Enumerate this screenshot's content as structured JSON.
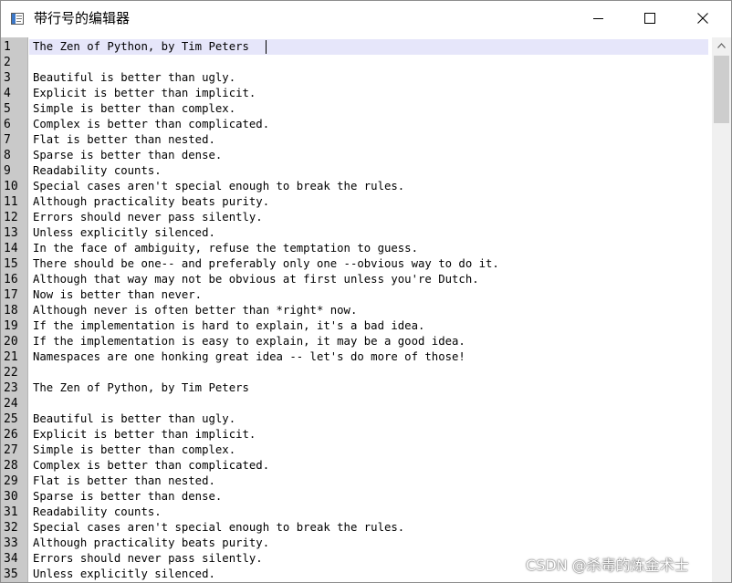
{
  "window": {
    "title": "带行号的编辑器",
    "controls": {
      "minimize": "minimize-icon",
      "maximize": "maximize-icon",
      "close": "close-icon"
    }
  },
  "editor": {
    "current_line": 1,
    "line_numbers": [
      "1",
      "2",
      "3",
      "4",
      "5",
      "6",
      "7",
      "8",
      "9",
      "10",
      "11",
      "12",
      "13",
      "14",
      "15",
      "16",
      "17",
      "18",
      "19",
      "20",
      "21",
      "22",
      "23",
      "24",
      "25",
      "26",
      "27",
      "28",
      "29",
      "30",
      "31",
      "32",
      "33",
      "34",
      "35"
    ],
    "lines": [
      "The Zen of Python, by Tim Peters",
      "",
      "Beautiful is better than ugly.",
      "Explicit is better than implicit.",
      "Simple is better than complex.",
      "Complex is better than complicated.",
      "Flat is better than nested.",
      "Sparse is better than dense.",
      "Readability counts.",
      "Special cases aren't special enough to break the rules.",
      "Although practicality beats purity.",
      "Errors should never pass silently.",
      "Unless explicitly silenced.",
      "In the face of ambiguity, refuse the temptation to guess.",
      "There should be one-- and preferably only one --obvious way to do it.",
      "Although that way may not be obvious at first unless you're Dutch.",
      "Now is better than never.",
      "Although never is often better than *right* now.",
      "If the implementation is hard to explain, it's a bad idea.",
      "If the implementation is easy to explain, it may be a good idea.",
      "Namespaces are one honking great idea -- let's do more of those!",
      "",
      "The Zen of Python, by Tim Peters",
      "",
      "Beautiful is better than ugly.",
      "Explicit is better than implicit.",
      "Simple is better than complex.",
      "Complex is better than complicated.",
      "Flat is better than nested.",
      "Sparse is better than dense.",
      "Readability counts.",
      "Special cases aren't special enough to break the rules.",
      "Although practicality beats purity.",
      "Errors should never pass silently.",
      "Unless explicitly silenced."
    ]
  },
  "scrollbar": {
    "up_arrow": "chevron-up-icon"
  },
  "watermark": "CSDN @杀毒的炼金术士",
  "colors": {
    "gutter_bg": "#c9c9c9",
    "current_line_bg": "#e6e6fa",
    "text": "#000000",
    "scrollbar_bg": "#f0f0f0",
    "scroll_thumb": "#cdcdcd"
  }
}
